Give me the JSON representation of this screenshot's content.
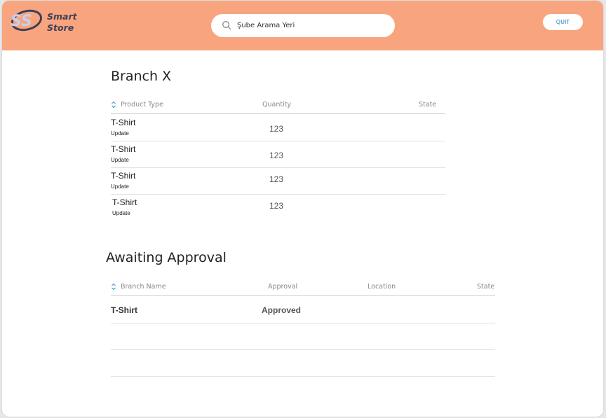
{
  "brand": {
    "line1": "Smart",
    "line2": "Store",
    "logo_mark": "SS",
    "accent": "#f8a57f"
  },
  "search": {
    "placeholder": "Şube Arama Yeri",
    "icon": "search-icon"
  },
  "header": {
    "quit_label": "QUIT"
  },
  "branch": {
    "title": "Branch X",
    "columns": [
      "Product Type",
      "Quantity",
      "State"
    ],
    "rows": [
      {
        "product": "T-Shirt",
        "action": "Update",
        "quantity": "123",
        "state": ""
      },
      {
        "product": "T-Shirt",
        "action": "Update",
        "quantity": "123",
        "state": ""
      },
      {
        "product": "T-Shirt",
        "action": "Update",
        "quantity": "123",
        "state": ""
      },
      {
        "product": "T-Shirt",
        "action": "Update",
        "quantity": "123",
        "state": ""
      }
    ]
  },
  "approval": {
    "title": "Awaiting Approval",
    "columns": [
      "Branch Name",
      "Approval",
      "Location",
      "State"
    ],
    "rows": [
      {
        "branch": "T-Shirt",
        "approval": "Approved",
        "location": "",
        "state": ""
      },
      {
        "branch": "",
        "approval": "",
        "location": "",
        "state": ""
      },
      {
        "branch": "",
        "approval": "",
        "location": "",
        "state": ""
      }
    ]
  }
}
